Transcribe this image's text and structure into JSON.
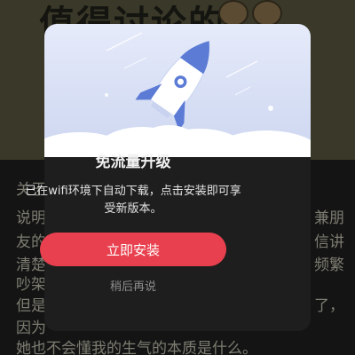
{
  "background": {
    "headline": "值得讨论的",
    "lines_left": [
      "关于",
      "说明",
      "友的",
      "清楚",
      "吵架",
      "但是",
      "因为"
    ],
    "lines_right": [
      "兼朋",
      "信讲",
      "频繁",
      "了，"
    ],
    "last_line": "她也不会懂我的生气的本质是什么。"
  },
  "dialog": {
    "title": "免流量升级",
    "message": "已在wifi环境下自动下载，点击安装即可享受新版本。",
    "install_label": "立即安装",
    "later_label": "稍后再说",
    "hero_icon": "rocket-icon",
    "colors": {
      "accent": "#e8404e",
      "hero_bg": "#dce3f6",
      "rocket": "#5b7bd5"
    }
  }
}
